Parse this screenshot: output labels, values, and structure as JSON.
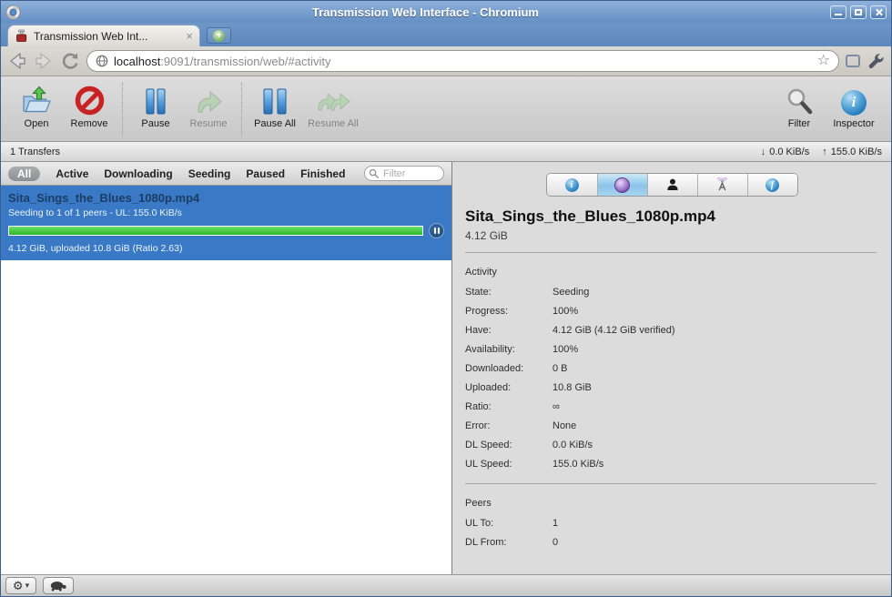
{
  "window": {
    "title": "Transmission Web Interface - Chromium"
  },
  "browser": {
    "tab_title": "Transmission Web Int...",
    "url_host": "localhost",
    "url_rest": ":9091/transmission/web/#activity"
  },
  "icons": {
    "tab_close": "×",
    "star": "☆",
    "gear": "⚙",
    "dropdown": "▾",
    "down_arrow": "↓",
    "up_arrow": "↑",
    "info_glyph": "i",
    "files_glyph": "f",
    "plus": "+"
  },
  "toolbar": {
    "buttons": [
      {
        "label": "Open"
      },
      {
        "label": "Remove"
      },
      {
        "label": "Pause"
      },
      {
        "label": "Resume"
      },
      {
        "label": "Pause All"
      },
      {
        "label": "Resume All"
      }
    ],
    "filter_label": "Filter",
    "inspector_label": "Inspector"
  },
  "statusline": {
    "transfers": "1 Transfers",
    "down_speed": "0.0 KiB/s",
    "up_speed": "155.0 KiB/s"
  },
  "filterbar": {
    "tabs": [
      "All",
      "Active",
      "Downloading",
      "Seeding",
      "Paused",
      "Finished"
    ],
    "selected": "All",
    "search_placeholder": "Filter"
  },
  "torrent": {
    "name": "Sita_Sings_the_Blues_1080p.mp4",
    "peers_line": "Seeding to 1 of 1 peers - UL: 155.0 KiB/s",
    "progress_pct": 100,
    "details_line": "4.12 GiB, uploaded 10.8 GiB (Ratio 2.63)"
  },
  "inspector": {
    "selected_tab": "activity",
    "title": "Sita_Sings_the_Blues_1080p.mp4",
    "size": "4.12 GiB",
    "activity": {
      "heading": "Activity",
      "rows": [
        {
          "label": "State:",
          "value": "Seeding"
        },
        {
          "label": "Progress:",
          "value": "100%"
        },
        {
          "label": "Have:",
          "value": "4.12 GiB (4.12 GiB verified)"
        },
        {
          "label": "Availability:",
          "value": "100%"
        },
        {
          "label": "Downloaded:",
          "value": "0 B"
        },
        {
          "label": "Uploaded:",
          "value": "10.8 GiB"
        },
        {
          "label": "Ratio:",
          "value": "∞"
        },
        {
          "label": "Error:",
          "value": "None"
        },
        {
          "label": "DL Speed:",
          "value": "0.0 KiB/s"
        },
        {
          "label": "UL Speed:",
          "value": "155.0 KiB/s"
        }
      ]
    },
    "peers": {
      "heading": "Peers",
      "rows": [
        {
          "label": "UL To:",
          "value": "1"
        },
        {
          "label": "DL From:",
          "value": "0"
        }
      ]
    }
  }
}
